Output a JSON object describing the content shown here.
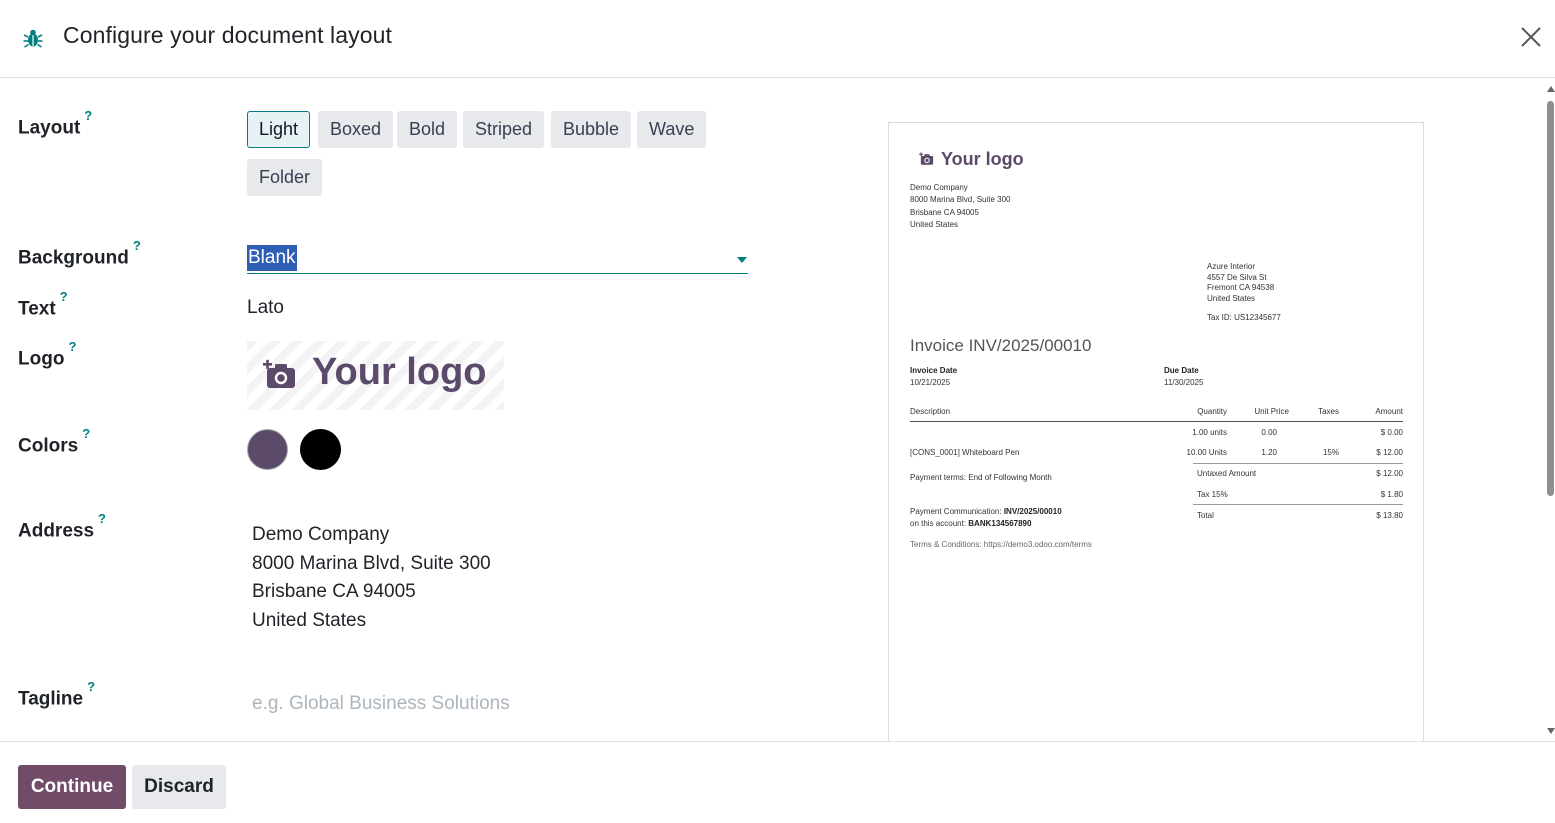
{
  "dialog": {
    "title": "Configure your document layout",
    "help_marker": "?"
  },
  "form": {
    "layout": {
      "label": "Layout",
      "options": [
        "Light",
        "Boxed",
        "Bold",
        "Striped",
        "Bubble",
        "Wave",
        "Folder"
      ],
      "selected": "Light"
    },
    "background": {
      "label": "Background",
      "value": "Blank"
    },
    "text": {
      "label": "Text",
      "value": "Lato"
    },
    "logo": {
      "label": "Logo",
      "placeholder_text": "Your logo"
    },
    "colors": {
      "label": "Colors",
      "primary": "#5c4a6b",
      "secondary": "#000000"
    },
    "address": {
      "label": "Address",
      "lines": [
        "Demo Company",
        "8000 Marina Blvd, Suite 300",
        "Brisbane CA 94005",
        "United States"
      ]
    },
    "tagline": {
      "label": "Tagline",
      "placeholder": "e.g. Global Business Solutions",
      "value": ""
    }
  },
  "preview": {
    "logo_text": "Your logo",
    "company_lines": [
      "Demo Company",
      "8000 Marina Blvd, Suite 300",
      "Brisbane CA 94005",
      "United States"
    ],
    "customer_lines": [
      "Azure Interior",
      "4557 De Silva St",
      "Fremont CA 94538",
      "United States"
    ],
    "tax_id": "Tax ID: US12345677",
    "invoice_title": "Invoice INV/2025/00010",
    "invoice_date_label": "Invoice Date",
    "invoice_date": "10/21/2025",
    "due_date_label": "Due Date",
    "due_date": "11/30/2025",
    "columns": [
      "Description",
      "Quantity",
      "Unit Price",
      "Taxes",
      "Amount"
    ],
    "rows": [
      {
        "description": "",
        "quantity": "1.00 units",
        "unit_price": "0.00",
        "taxes": "",
        "amount": "$ 0.00"
      },
      {
        "description": "[CONS_0001] Whiteboard Pen",
        "quantity": "10.00 Units",
        "unit_price": "1.20",
        "taxes": "15%",
        "amount": "$ 12.00"
      }
    ],
    "payment_terms": "Payment terms: End of Following Month",
    "untaxed_label": "Untaxed Amount",
    "untaxed_value": "$ 12.00",
    "tax_label": "Tax 15%",
    "tax_value": "$ 1.80",
    "total_label": "Total",
    "total_value": "$ 13.80",
    "payment_comm_prefix": "Payment Communication:",
    "payment_comm_value": "INV/2025/00010",
    "account_prefix": "on this account:",
    "account_value": "BANK134567890",
    "terms": "Terms & Conditions: https://demo3.odoo.com/terms"
  },
  "footer": {
    "continue_label": "Continue",
    "discard_label": "Discard"
  },
  "theme": {
    "accent": "#017e84",
    "primary_button": "#714b67",
    "selection": "#2e5fb4"
  }
}
